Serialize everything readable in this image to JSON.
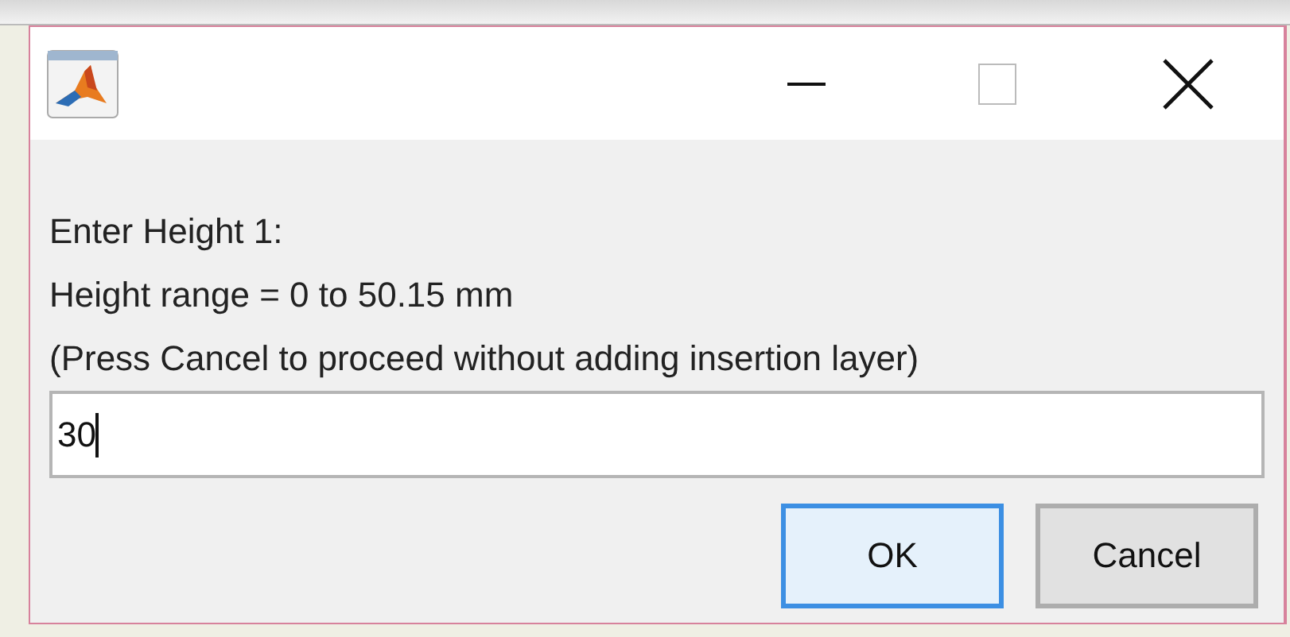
{
  "dialog": {
    "messages": [
      "Enter Height 1:",
      "Height range = 0 to 50.15 mm",
      "(Press Cancel to proceed without adding insertion layer)"
    ],
    "input": {
      "value": "30",
      "focused": true
    },
    "buttons": [
      {
        "label": "OK",
        "default": true
      },
      {
        "label": "Cancel",
        "default": false
      }
    ]
  }
}
